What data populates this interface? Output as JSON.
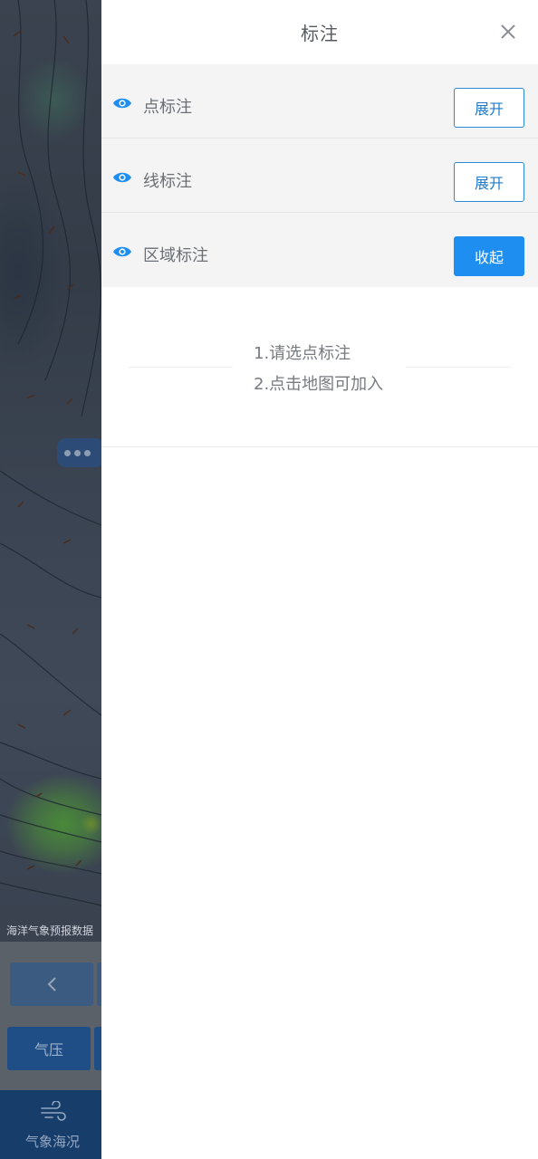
{
  "map": {
    "data_label": "海洋气象预报数据",
    "prev_icon": "chevron-left-icon",
    "pressure_label": "气压",
    "tab_icon": "wind-icon",
    "tab_label": "气象海况",
    "more_icon": "more-dots-icon"
  },
  "panel": {
    "title": "标注",
    "close_icon": "close-icon",
    "rows": [
      {
        "label": "点标注",
        "button": "展开",
        "icon": "eye-icon"
      },
      {
        "label": "线标注",
        "button": "展开",
        "icon": "eye-icon"
      },
      {
        "label": "区域标注",
        "button": "收起",
        "icon": "eye-icon"
      }
    ],
    "instructions": [
      "1.请选点标注",
      "2.点击地图可加入"
    ]
  },
  "colors": {
    "accent": "#1e8ef1",
    "row_bg": "#f4f4f4",
    "map_tabbar": "#173d6a"
  }
}
